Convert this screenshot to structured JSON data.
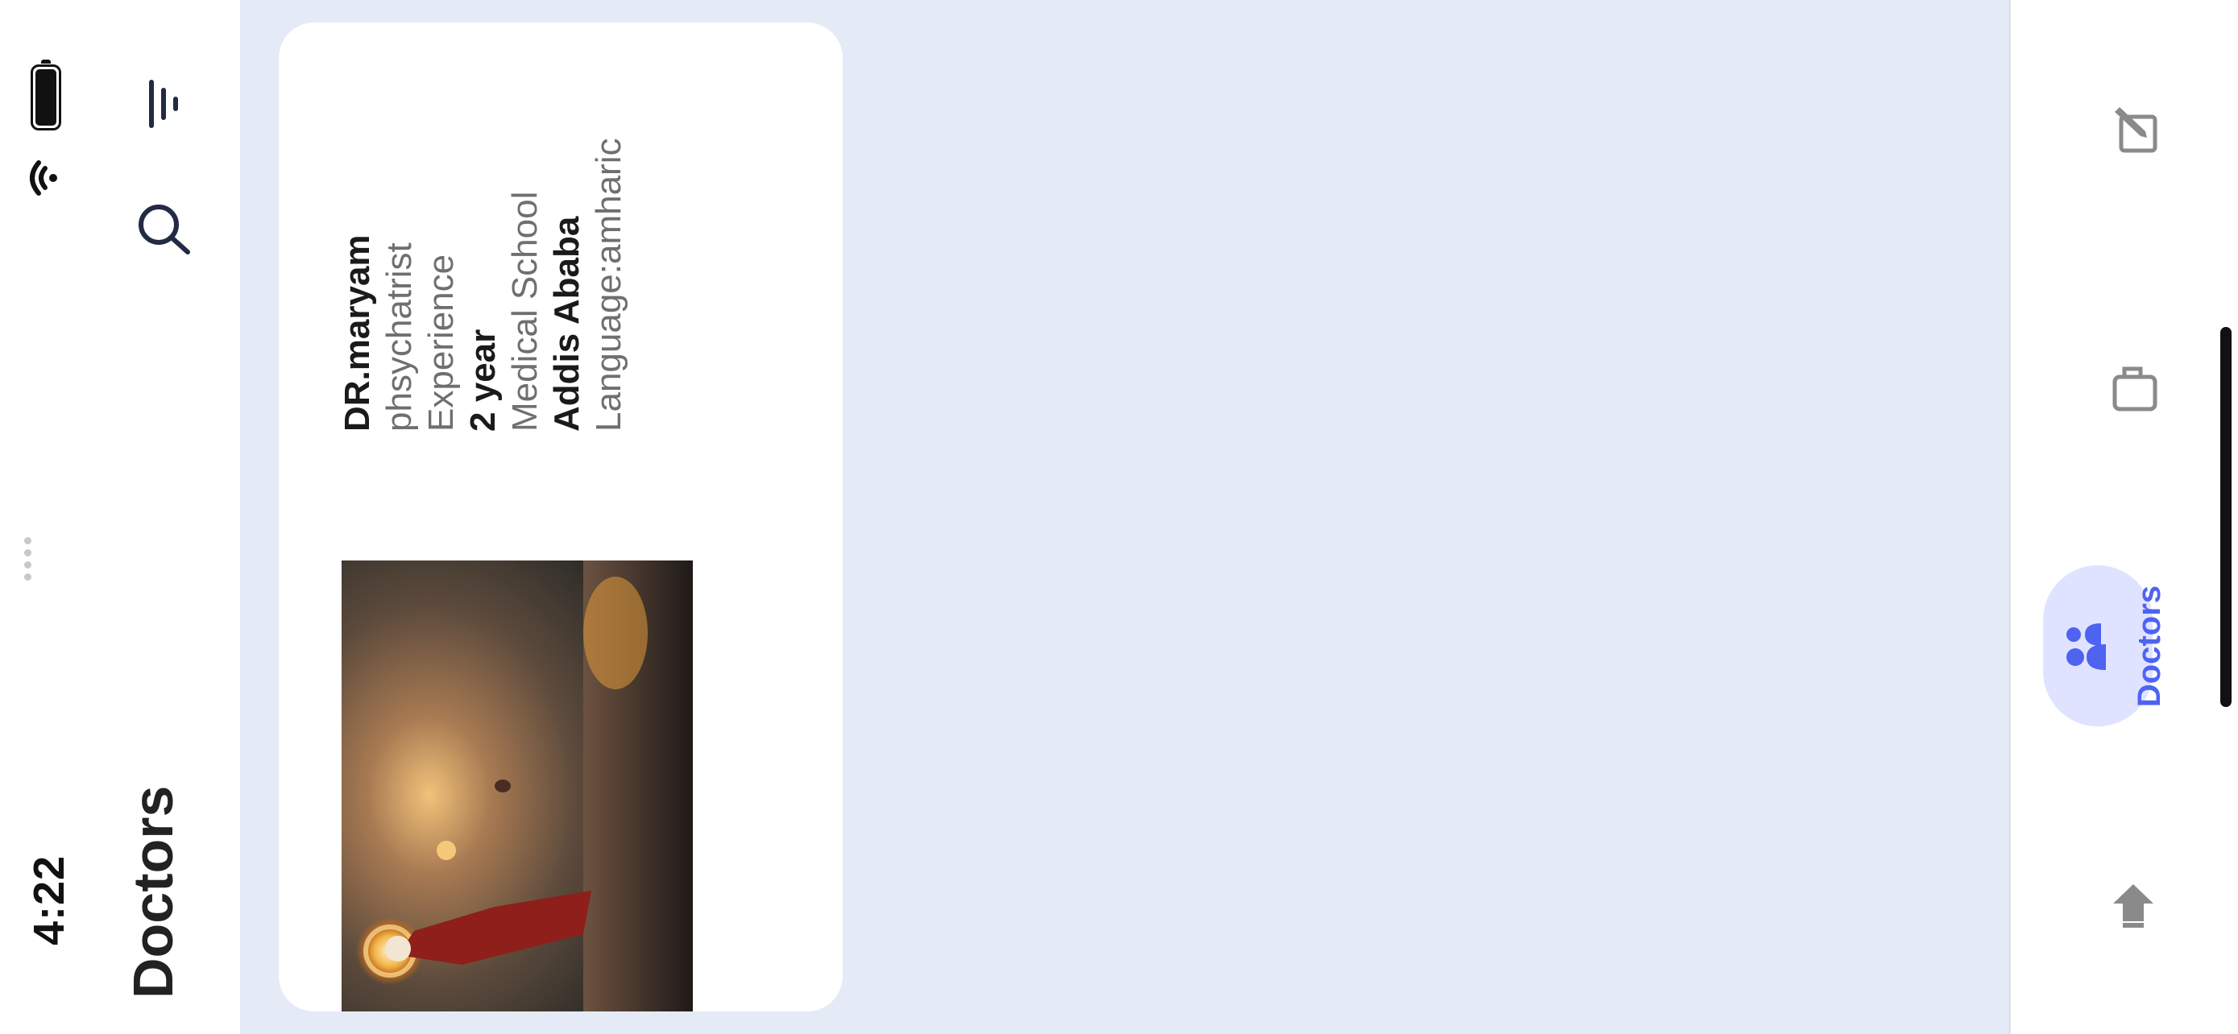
{
  "status_bar": {
    "time": "4:22"
  },
  "app_bar": {
    "title": "Doctors",
    "icons": [
      "filter-icon",
      "search-icon"
    ]
  },
  "doctors": [
    {
      "name": "DR.maryam",
      "specialty": "phsychatrist",
      "experience_label": "Experience",
      "experience_value": "2 year",
      "school_label": "Medical School",
      "school_value": "Addis Ababa",
      "language": "Language:amharic"
    }
  ],
  "bottom_nav": {
    "items": [
      {
        "icon": "logout-arrow-icon",
        "label": ""
      },
      {
        "icon": "people-icon",
        "label": "Doctors",
        "active": true
      },
      {
        "icon": "mug-icon",
        "label": ""
      },
      {
        "icon": "edit-note-icon",
        "label": ""
      }
    ],
    "accent": "#4e63f0",
    "active_pill": "#dfe3ff"
  },
  "colors": {
    "background": "#e4ebf7",
    "surface": "#ffffff",
    "text_primary": "#1a1a1a",
    "text_secondary": "#6f6f6f"
  }
}
